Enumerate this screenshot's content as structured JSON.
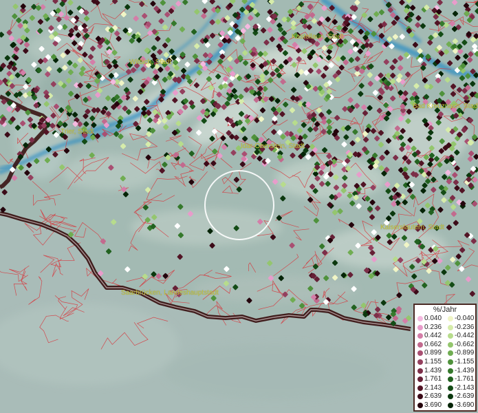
{
  "cities": [
    {
      "id": "kastellaun",
      "label": "Kastellaun, Stadt"
    },
    {
      "id": "wittlich",
      "label": "Wittlich, Stadt"
    },
    {
      "id": "bad-kreuznach",
      "label": "Bad Kreuznach, Stadt"
    },
    {
      "id": "trier",
      "label": "Trier, Stadt"
    },
    {
      "id": "idar-oberstein",
      "label": "Idar-Oberstein, Stadt"
    },
    {
      "id": "kaiserslautern",
      "label": "Kaiserslautern, Stadt"
    },
    {
      "id": "saarbruecken",
      "label": "Saarbrücken, Landeshauptstadt"
    }
  ],
  "legend": {
    "title": "%/Jahr",
    "positive": [
      {
        "value": "0.040",
        "color": "#f4b9e0"
      },
      {
        "value": "0.236",
        "color": "#e89ccb"
      },
      {
        "value": "0.442",
        "color": "#d47ea8"
      },
      {
        "value": "0.662",
        "color": "#c26a8e"
      },
      {
        "value": "0.899",
        "color": "#a94f72"
      },
      {
        "value": "1.155",
        "color": "#94405e"
      },
      {
        "value": "1.439",
        "color": "#7c2e48"
      },
      {
        "value": "1.761",
        "color": "#662036"
      },
      {
        "value": "2.143",
        "color": "#521425"
      },
      {
        "value": "2.639",
        "color": "#3c0b18"
      },
      {
        "value": "3.690",
        "color": "#24040c"
      }
    ],
    "negative": [
      {
        "value": "-0.040",
        "color": "#f0f5c6"
      },
      {
        "value": "-0.236",
        "color": "#d6ecaa"
      },
      {
        "value": "-0.442",
        "color": "#b7dc8c"
      },
      {
        "value": "-0.662",
        "color": "#94c66e"
      },
      {
        "value": "-0.899",
        "color": "#70ad52"
      },
      {
        "value": "-1.155",
        "color": "#4f923c"
      },
      {
        "value": "-1.439",
        "color": "#35792c"
      },
      {
        "value": "-1.761",
        "color": "#226220"
      },
      {
        "value": "-2.143",
        "color": "#144c16"
      },
      {
        "value": "-2.639",
        "color": "#0b380e"
      },
      {
        "value": "-3.690",
        "color": "#052407"
      }
    ]
  },
  "colors": {
    "outside_area": "#a9bcb8",
    "inside_area": "#a6bcb6",
    "border_line": "#3a1414",
    "admin_lines": "#d8343a",
    "river": "#2f8fc4",
    "label": "#c9c83a"
  }
}
